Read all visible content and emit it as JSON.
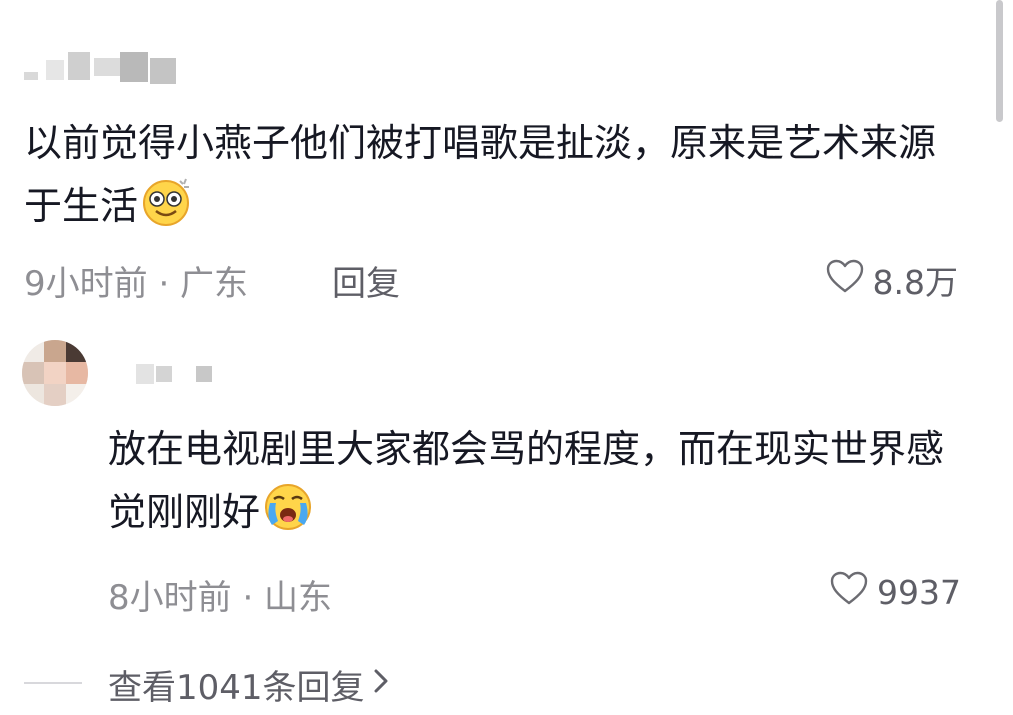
{
  "comments": [
    {
      "text": "以前觉得小燕子他们被打唱歌是扯淡，原来是艺术来源于生活",
      "emoji": "dizzy-eyes-emoji",
      "meta": "9小时前 · 广东",
      "reply_label": "回复",
      "likes": "8.8万"
    },
    {
      "text": "放在电视剧里大家都会骂的程度，而在现实世界感觉刚刚好",
      "emoji": "crying-emoji",
      "meta": "8小时前 · 山东",
      "likes": "9937"
    }
  ],
  "view_replies": "查看1041条回复",
  "icons": {
    "like": "heart-outline-icon",
    "chevron": "chevron-right-icon"
  },
  "colors": {
    "text": "#161823",
    "meta": "#8e8e93",
    "secondary": "#5e5e66"
  }
}
